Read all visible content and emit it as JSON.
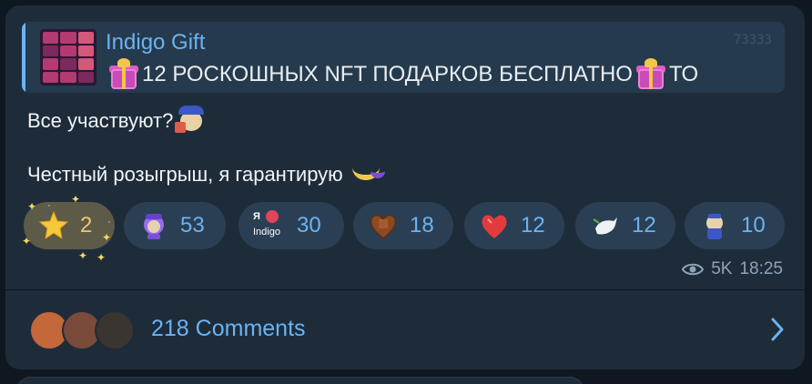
{
  "reply": {
    "title": "Indigo Gift",
    "text": "12 РОСКОШНЫХ NFT ПОДАРКОВ БЕСПЛАТНО",
    "text_suffix": "ТО",
    "watermark": "7ЗЗЗЗ"
  },
  "message": {
    "line1": "Все участвуют?",
    "line2": "Честный розыгрыш, я гарантирую"
  },
  "reactions": [
    {
      "emoji": "star-icon",
      "count": "2",
      "color": "#f6c83c",
      "active": true
    },
    {
      "emoji": "hamster-sticker-icon",
      "count": "53",
      "color": "#8b5cf6",
      "active": false
    },
    {
      "emoji": "indigo-heart-icon",
      "label_top": "Я",
      "label_bottom": "Indigo",
      "count": "30",
      "color": "#e0455a",
      "active": false
    },
    {
      "emoji": "chocolate-heart-icon",
      "count": "18",
      "color": "#8a4a24",
      "active": false
    },
    {
      "emoji": "red-heart-icon",
      "count": "12",
      "color": "#e23b3b",
      "active": false
    },
    {
      "emoji": "dove-icon",
      "count": "12",
      "color": "#e8ecf0",
      "active": false
    },
    {
      "emoji": "hamster-blue-icon",
      "count": "10",
      "color": "#3c57c8",
      "active": false
    }
  ],
  "meta": {
    "views": "5K",
    "time": "18:25"
  },
  "comments": {
    "label": "218 Comments"
  }
}
